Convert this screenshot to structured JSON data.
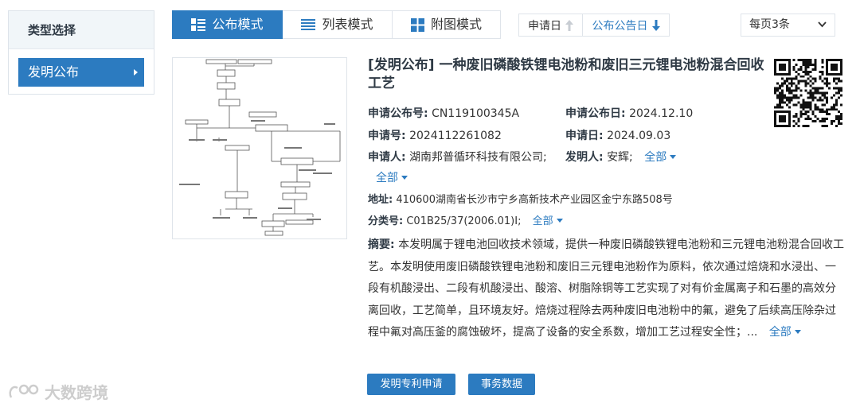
{
  "sidebar": {
    "header": "类型选择",
    "items": [
      {
        "label": "发明公布",
        "active": true
      }
    ]
  },
  "toolbar": {
    "tabs": [
      {
        "label": "公布模式",
        "icon": "list-detail-icon",
        "active": true
      },
      {
        "label": "列表模式",
        "icon": "list-icon",
        "active": false
      },
      {
        "label": "附图模式",
        "icon": "grid-icon",
        "active": false
      }
    ],
    "sort": [
      {
        "label": "申请日",
        "icon": "arrow-up-icon",
        "active": false
      },
      {
        "label": "公布公告日",
        "icon": "arrow-down-icon",
        "active": true
      }
    ],
    "per_page": "每页3条"
  },
  "result": {
    "title": "[发明公布] 一种废旧磷酸铁锂电池粉和废旧三元锂电池粉混合回收工艺",
    "pub_no_label": "申请公布号:",
    "pub_no": "CN119100345A",
    "pub_date_label": "申请公布日:",
    "pub_date": "2024.12.10",
    "app_no_label": "申请号:",
    "app_no": "2024112261082",
    "app_date_label": "申请日:",
    "app_date": "2024.09.03",
    "applicant_label": "申请人:",
    "applicant": "湖南邦普循环科技有限公司;",
    "inventor_label": "发明人:",
    "inventor": "安辉;",
    "more": "全部",
    "address_label": "地址:",
    "address": "410600湖南省长沙市宁乡高新技术产业园区金宁东路508号",
    "class_label": "分类号:",
    "class": "C01B25/37(2006.01)I;",
    "abstract_label": "摘要:",
    "abstract": "本发明属于锂电池回收技术领域，提供一种废旧磷酸铁锂电池粉和三元锂电池粉混合回收工艺。本发明使用废旧磷酸铁锂电池粉和废旧三元锂电池粉作为原料，依次通过焙烧和水浸出、一段有机酸浸出、二段有机酸浸出、酸溶、树脂除铜等工艺实现了对有价金属离子和石墨的高效分离回收，工艺简单，且环境友好。焙烧过程除去两种废旧电池粉中的氟，避免了后续高压除杂过程中氟对高压釜的腐蚀破坏，提高了设备的安全系数，增加工艺过程安全性；...",
    "buttons": [
      "发明专利申请",
      "事务数据"
    ]
  },
  "watermark": "大数跨境",
  "colors": {
    "accent": "#2c7bc0",
    "title": "#2f3a45"
  }
}
